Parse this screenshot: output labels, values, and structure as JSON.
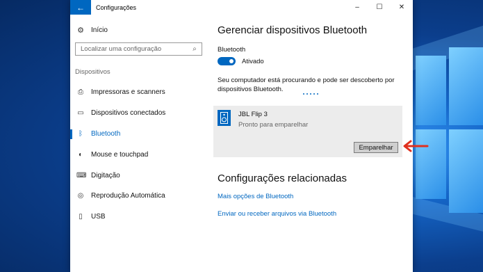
{
  "window": {
    "title": "Configurações",
    "back_icon": "←",
    "minimize_icon": "–",
    "maximize_icon": "☐",
    "close_icon": "✕"
  },
  "sidebar": {
    "home_label": "Início",
    "home_icon": "⚙",
    "search_placeholder": "Localizar uma configuração",
    "search_icon": "⌕",
    "section_label": "Dispositivos",
    "items": [
      {
        "label": "Impressoras e scanners",
        "icon": "⎙",
        "active": false
      },
      {
        "label": "Dispositivos conectados",
        "icon": "▭",
        "active": false
      },
      {
        "label": "Bluetooth",
        "icon": "ᛒ",
        "active": true
      },
      {
        "label": "Mouse e touchpad",
        "icon": "◐",
        "active": false
      },
      {
        "label": "Digitação",
        "icon": "⌨",
        "active": false
      },
      {
        "label": "Reprodução Automática",
        "icon": "◎",
        "active": false
      },
      {
        "label": "USB",
        "icon": "▯",
        "active": false
      }
    ]
  },
  "main": {
    "title": "Gerenciar dispositivos Bluetooth",
    "bluetooth_label": "Bluetooth",
    "toggle_state": "Ativado",
    "discover_text": "Seu computador está procurando e pode ser descoberto por dispositivos Bluetooth.",
    "device": {
      "name": "JBL Flip 3",
      "status": "Pronto para emparelhar",
      "pair_button": "Emparelhar"
    },
    "related_title": "Configurações relacionadas",
    "links": [
      "Mais opções de Bluetooth",
      "Enviar ou receber arquivos via Bluetooth"
    ]
  },
  "colors": {
    "accent": "#0067c0",
    "annotation_arrow": "#e0301e"
  }
}
